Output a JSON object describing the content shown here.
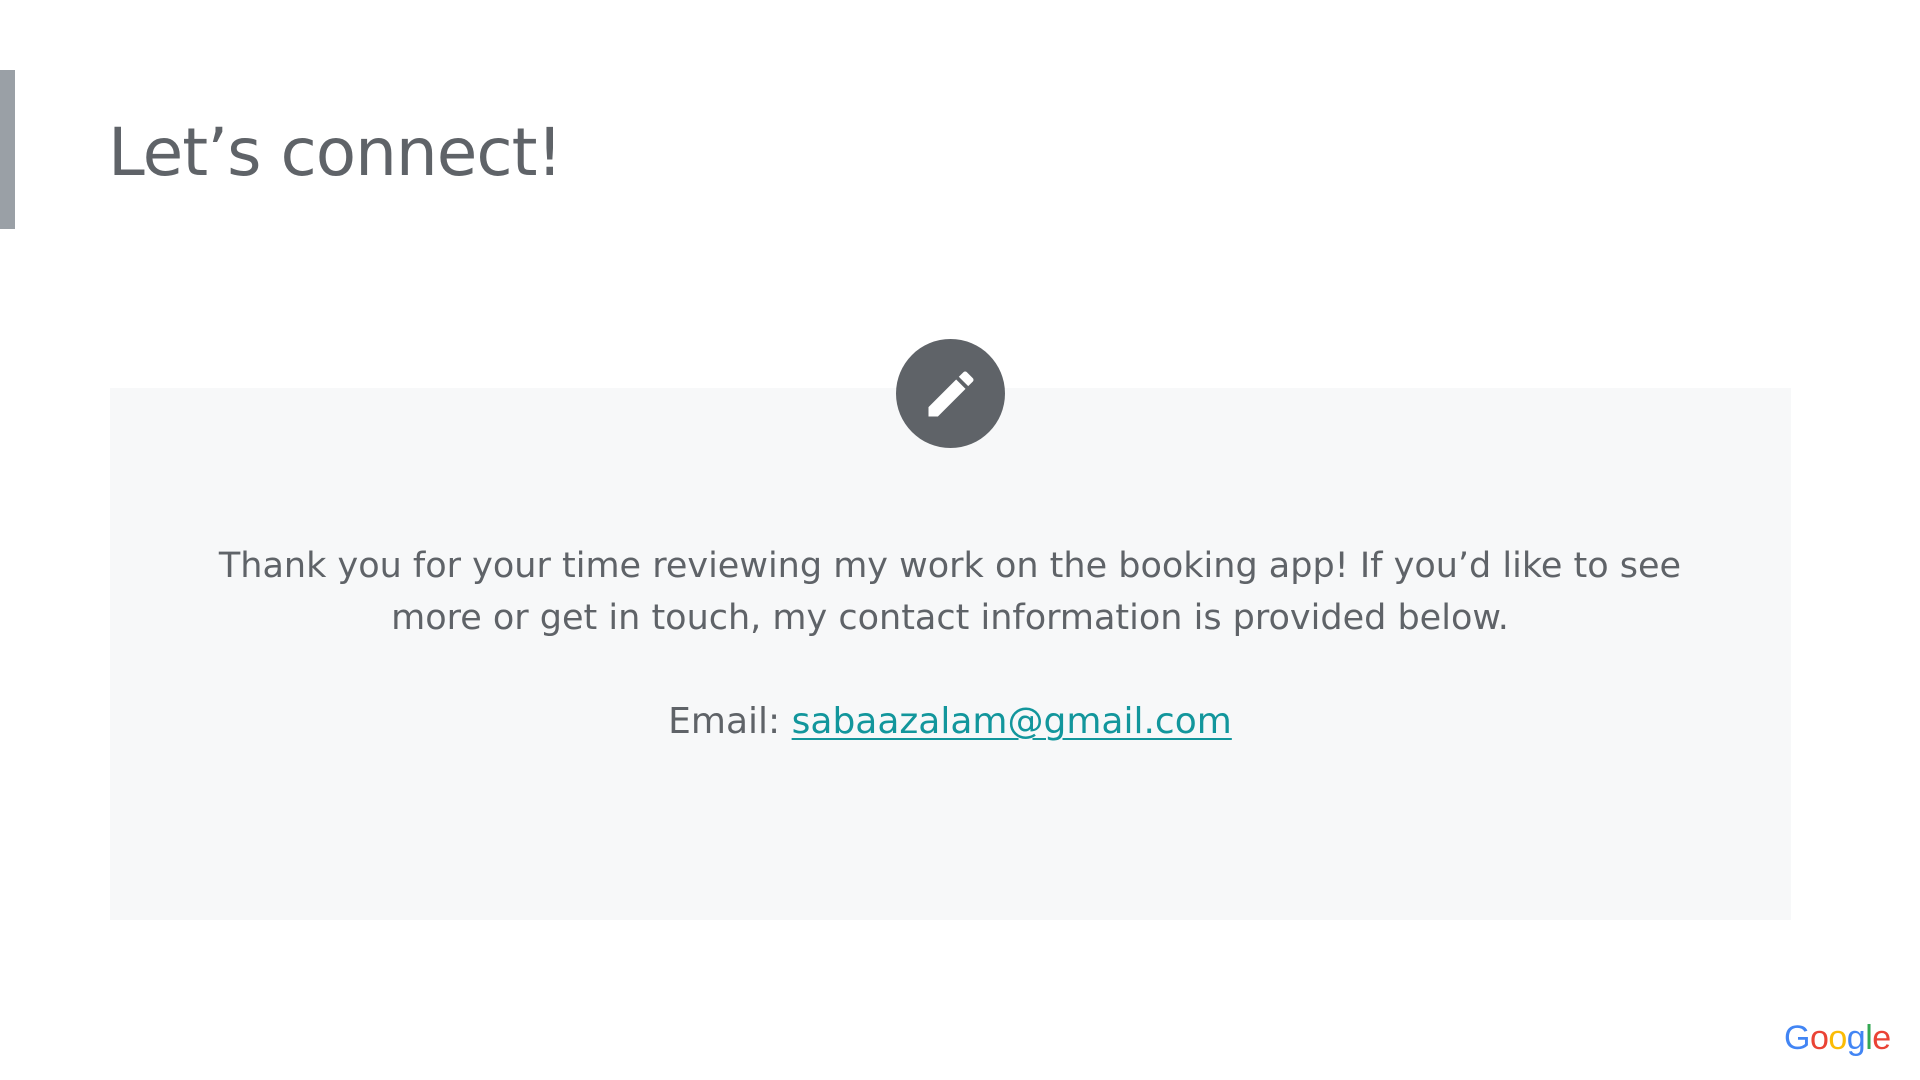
{
  "slide": {
    "title": "Let’s connect!",
    "message": "Thank you for your time reviewing my work on the booking app! If you’d like to see more or get in touch, my contact information is provided below.",
    "email_label": "Email: ",
    "email_address": "sabaazalam@gmail.com",
    "icon": "pencil-icon",
    "logo": {
      "letters": [
        "G",
        "o",
        "o",
        "g",
        "l",
        "e"
      ]
    }
  },
  "colors": {
    "accent_bar": "#9aa0a6",
    "text": "#5f6368",
    "card_background": "#f7f8f9",
    "icon_circle": "#5f6368",
    "link": "#12969c"
  }
}
